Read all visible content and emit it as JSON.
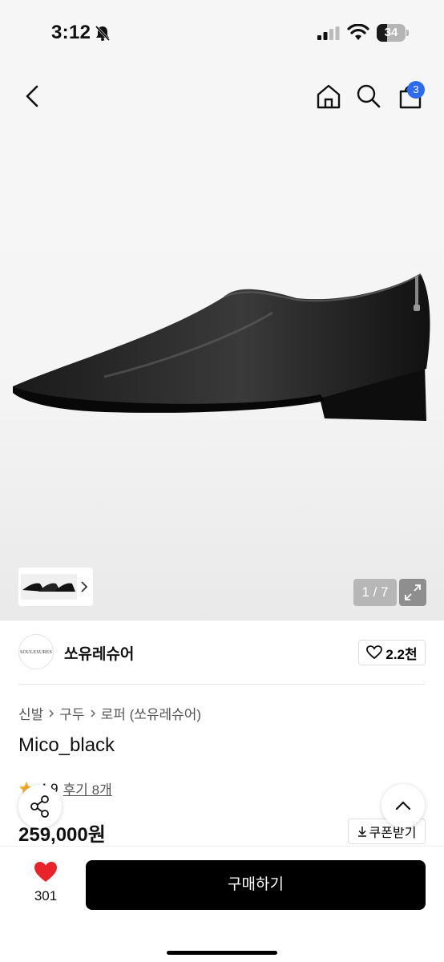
{
  "status": {
    "time": "3:12",
    "battery": "34"
  },
  "header": {
    "cart_count": "3"
  },
  "gallery": {
    "counter": "1 / 7"
  },
  "brand": {
    "logo_text": "SOULESURES",
    "name": "쏘유레슈어",
    "likes": "2.2천"
  },
  "breadcrumb": {
    "items": [
      "신발",
      "구두",
      "로퍼 (쏘유레슈어)"
    ]
  },
  "product": {
    "title": "Mico_black",
    "rating": "4.9",
    "reviews": "후기 8개",
    "price": "259,000원",
    "coupon_label": "쿠폰받기"
  },
  "bottom": {
    "wish_count": "301",
    "buy_label": "구매하기"
  },
  "colors": {
    "accent": "#2d6bf0",
    "heart": "#e8232a",
    "star": "#f5a623",
    "buy_bg": "#000000"
  }
}
